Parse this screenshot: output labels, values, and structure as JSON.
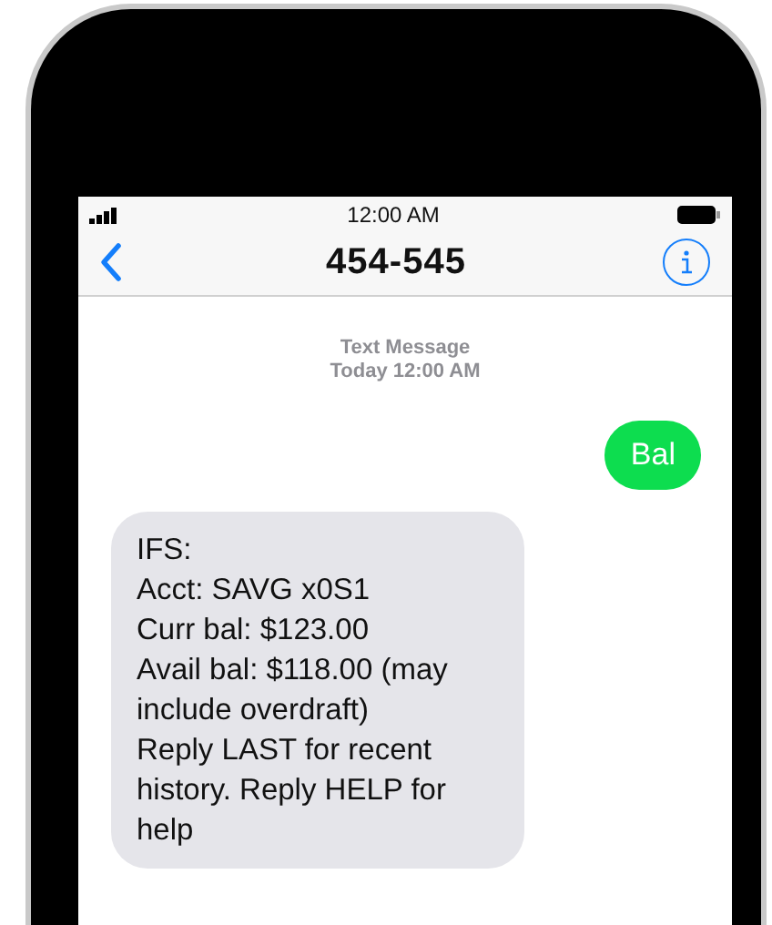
{
  "status_bar": {
    "time": "12:00 AM"
  },
  "nav": {
    "title": "454-545"
  },
  "thread_header": {
    "label": "Text Message",
    "time": "Today 12:00 AM"
  },
  "messages": [
    {
      "kind": "sent",
      "lines": [
        "Bal"
      ]
    },
    {
      "kind": "received",
      "lines": [
        "IFS:",
        "Acct: SAVG x0S1",
        "Curr bal: $123.00",
        "Avail bal: $118.00 (may",
        "include overdraft)",
        "Reply LAST for recent",
        "history. Reply HELP for",
        "help"
      ]
    }
  ]
}
